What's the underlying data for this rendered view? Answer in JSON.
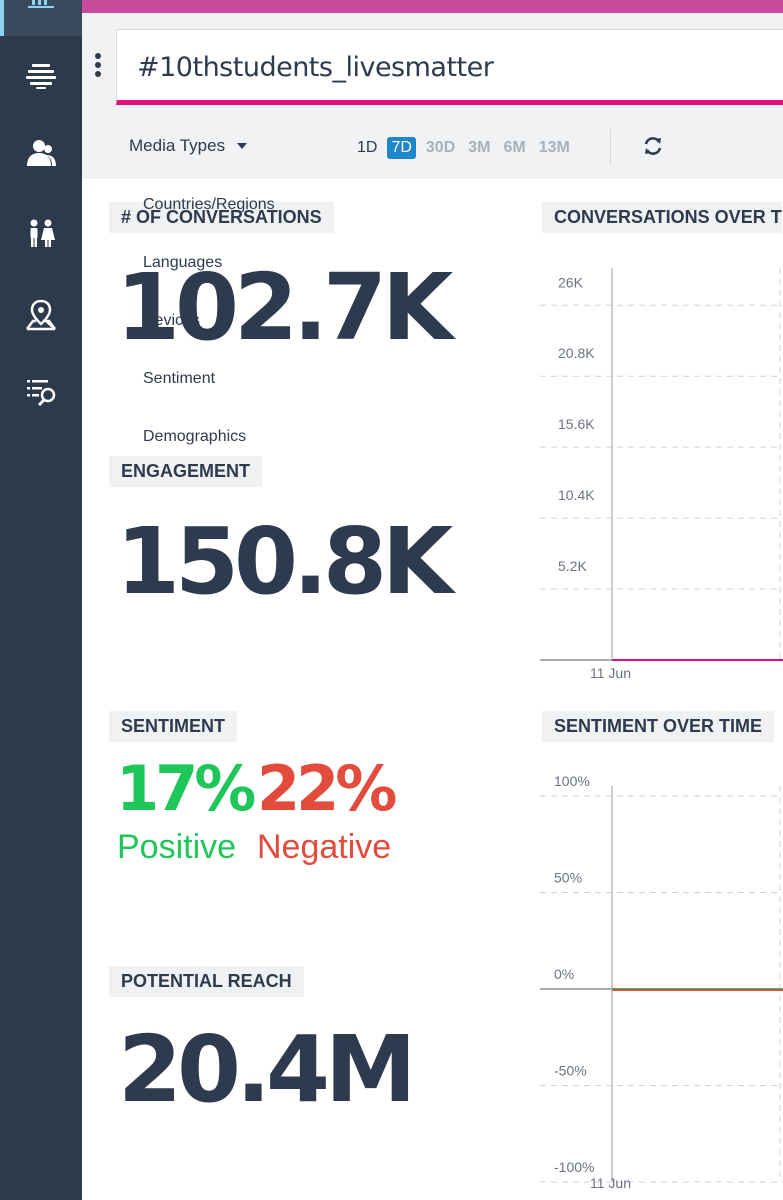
{
  "sidebar": {
    "icons": [
      "dashboard-icon",
      "stream-icon",
      "user-icon",
      "demographics-icon",
      "location-icon",
      "search-list-icon"
    ]
  },
  "header": {
    "query": "#10thstudents_livesmatter",
    "media_types_label": "Media Types",
    "ranges": [
      "1D",
      "7D",
      "30D",
      "3M",
      "6M",
      "13M"
    ],
    "active_range": "7D"
  },
  "dropdown_items": [
    "Countries/Regions",
    "Languages",
    "Devices",
    "Sentiment",
    "Demographics"
  ],
  "metrics": {
    "conversations": {
      "label": "# OF CONVERSATIONS",
      "value": "102.7K"
    },
    "engagement": {
      "label": "ENGAGEMENT",
      "value": "150.8K"
    },
    "sentiment": {
      "label": "SENTIMENT",
      "positive_value": "17%",
      "positive_label": "Positive",
      "negative_value": "22%",
      "negative_label": "Negative"
    },
    "reach": {
      "label": "POTENTIAL REACH",
      "value": "20.4M"
    }
  },
  "colors": {
    "accent": "#e0117f",
    "topbar": "#c84c9b",
    "positive": "#1fc65a",
    "negative": "#e34b3d",
    "sidebar": "#2c3a4b",
    "active_range": "#1f86c9"
  },
  "chart_data": [
    {
      "type": "line",
      "title": "CONVERSATIONS OVER T",
      "y_ticks": [
        "26K",
        "20.8K",
        "15.6K",
        "10.4K",
        "5.2K"
      ],
      "y_tick_values": [
        26000,
        20800,
        15600,
        10400,
        5200
      ],
      "x_ticks": [
        "11 Jun"
      ],
      "ylim": [
        0,
        28000
      ],
      "grid": true,
      "series": [
        {
          "color": "#e0117f",
          "x": [
            "11 Jun"
          ],
          "values": [
            0
          ]
        }
      ]
    },
    {
      "type": "line",
      "title": "SENTIMENT OVER TIME",
      "y_ticks": [
        "100%",
        "50%",
        "0%",
        "-50%",
        "-100%"
      ],
      "y_tick_values": [
        100,
        50,
        0,
        -50,
        -100
      ],
      "x_ticks": [
        "11 Jun"
      ],
      "ylim": [
        -100,
        100
      ],
      "grid": true,
      "series": [
        {
          "color": "#1fc65a",
          "x": [
            "11 Jun"
          ],
          "values": [
            0
          ]
        },
        {
          "color": "#e34b3d",
          "x": [
            "11 Jun"
          ],
          "values": [
            0
          ]
        }
      ]
    }
  ]
}
